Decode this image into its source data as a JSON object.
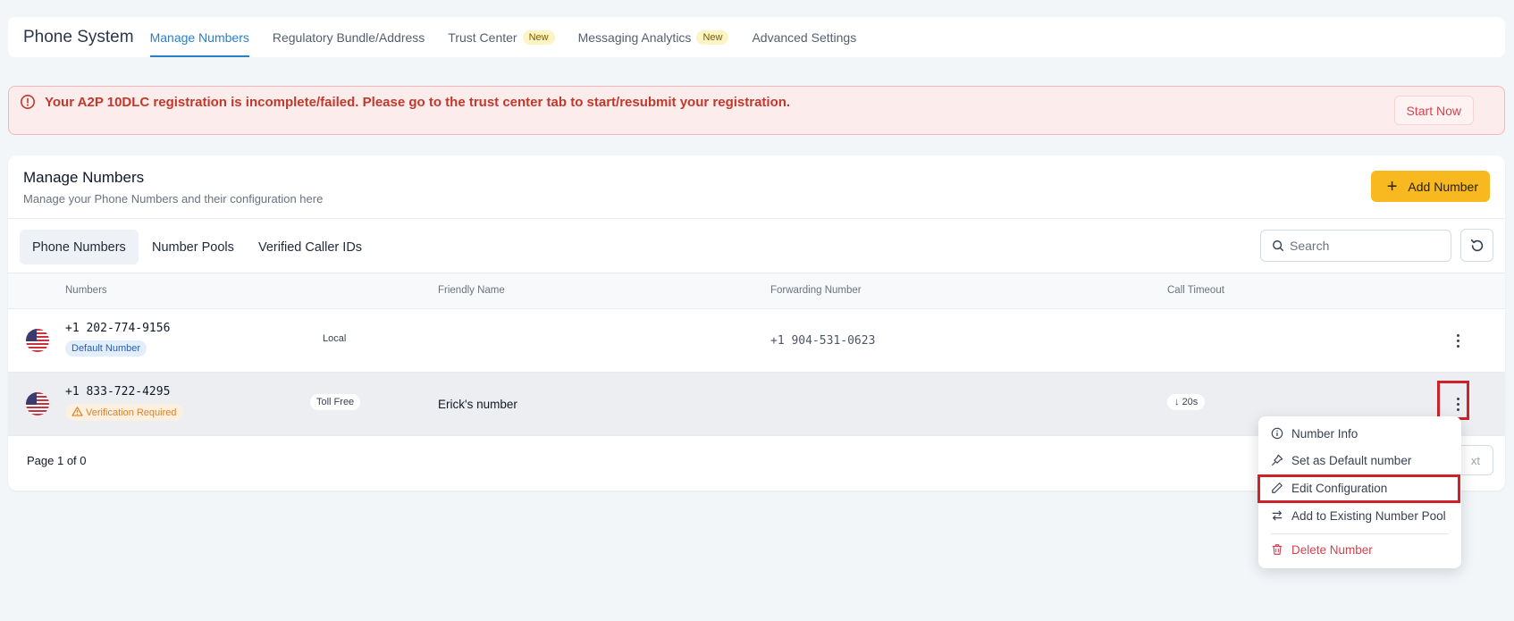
{
  "app": {
    "title": "Phone System"
  },
  "nav": {
    "tabs": [
      {
        "label": "Manage Numbers",
        "active": true
      },
      {
        "label": "Regulatory Bundle/Address"
      },
      {
        "label": "Trust Center",
        "badge": "New"
      },
      {
        "label": "Messaging Analytics",
        "badge": "New"
      },
      {
        "label": "Advanced Settings"
      }
    ]
  },
  "alert": {
    "text": "Your A2P 10DLC registration is incomplete/failed. Please go to the trust center tab to start/resubmit your registration.",
    "button": "Start Now",
    "icon": "info-circle-icon",
    "color": "#c0392b"
  },
  "card": {
    "title": "Manage Numbers",
    "subtitle": "Manage your Phone Numbers and their configuration here",
    "add_button": "Add Number",
    "add_icon": "+",
    "accent": "#f8b820"
  },
  "subtabs": [
    {
      "label": "Phone Numbers",
      "active": true
    },
    {
      "label": "Number Pools"
    },
    {
      "label": "Verified Caller IDs"
    }
  ],
  "search": {
    "placeholder": "Search"
  },
  "table": {
    "headers": [
      "Numbers",
      "Friendly Name",
      "Forwarding Number",
      "Call Timeout"
    ],
    "rows": [
      {
        "number": "+1 202-774-9156",
        "badge": "Default Number",
        "type": "Local",
        "friendly": "",
        "forwarding": "+1 904-531-0623",
        "timeout": ""
      },
      {
        "number": "+1 833-722-4295",
        "badge": "Verification Required",
        "type": "Toll Free",
        "friendly": "Erick's number",
        "forwarding": "",
        "timeout": "20s"
      }
    ]
  },
  "pager": {
    "text": "Page 1 of 0",
    "next": "Next",
    "next_visible": "xt"
  },
  "menu": {
    "items": [
      {
        "label": "Number Info",
        "icon": "info-icon"
      },
      {
        "label": "Set as Default number",
        "icon": "pin-icon"
      },
      {
        "label": "Edit Configuration",
        "icon": "pencil-icon"
      },
      {
        "label": "Add to Existing Number Pool",
        "icon": "swap-icon"
      },
      {
        "label": "Delete Number",
        "icon": "trash-icon",
        "danger": true
      }
    ]
  }
}
